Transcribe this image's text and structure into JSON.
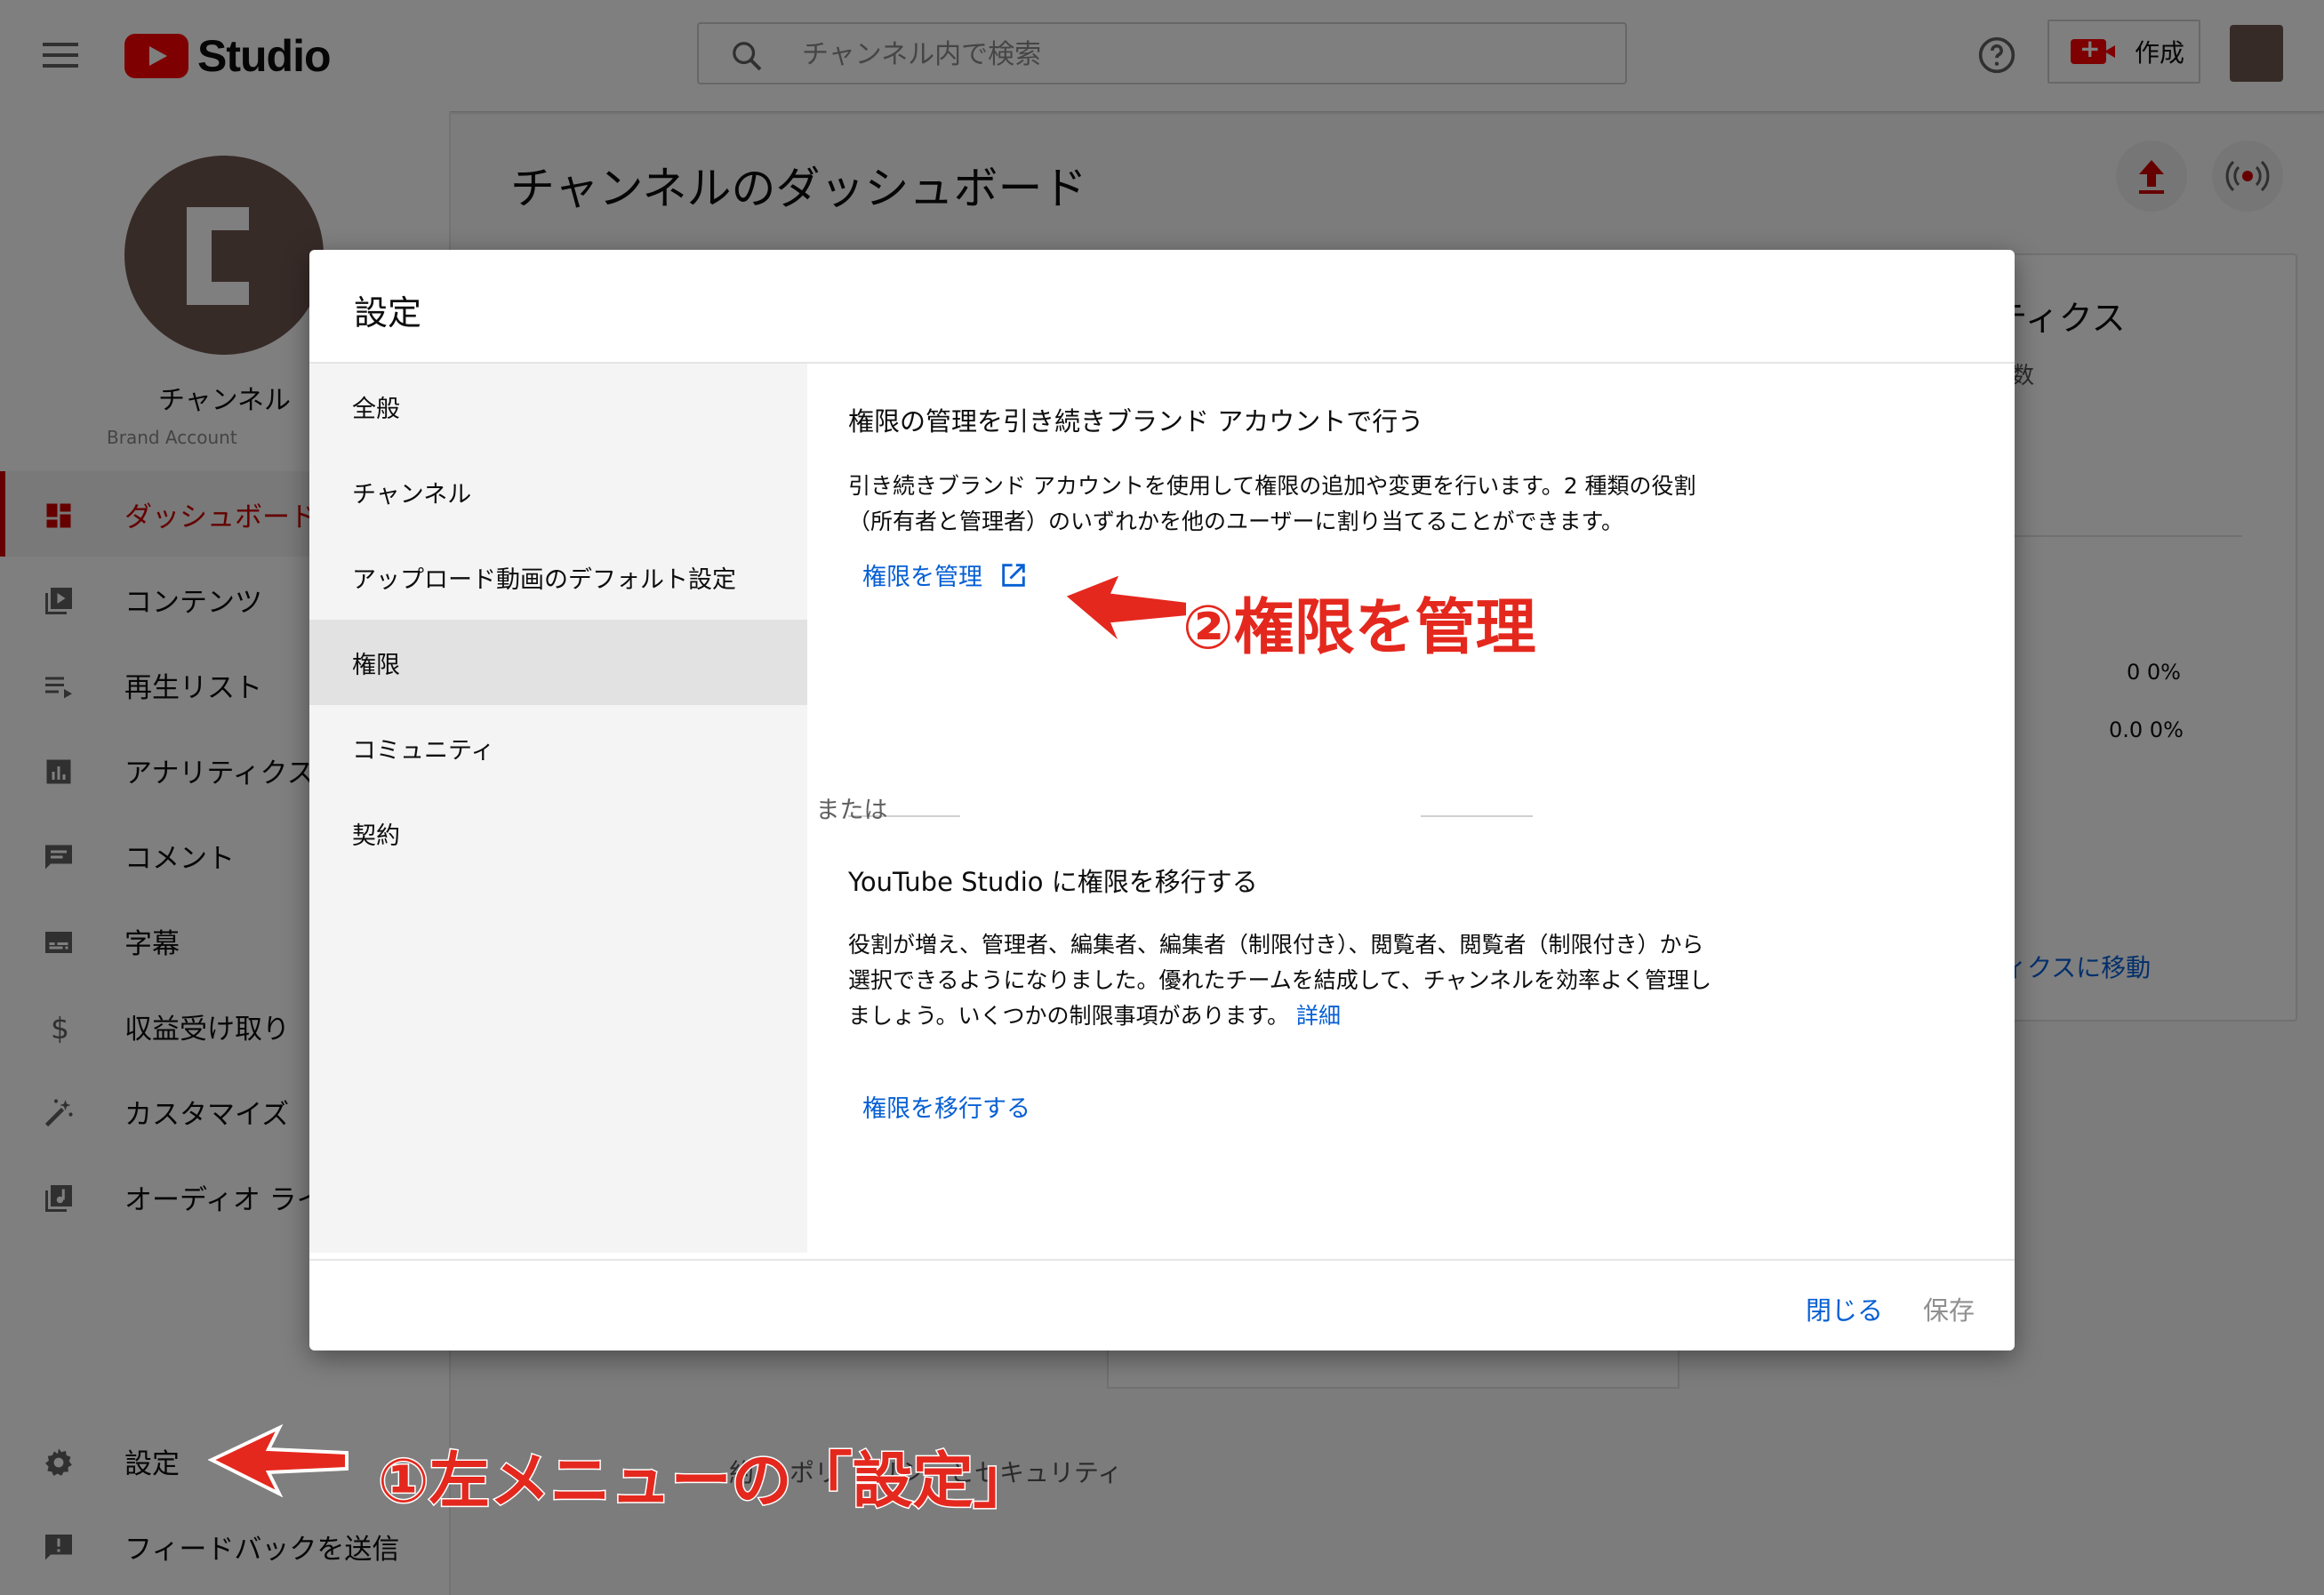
{
  "app": {
    "logo_text": "Studio",
    "search_placeholder": "チャンネル内で検索",
    "create_label": "作成"
  },
  "sidebar": {
    "channel_name": "チャンネル",
    "channel_sub": "Brand Account",
    "items": [
      {
        "label": "ダッシュボード",
        "icon": "dashboard-icon",
        "active": true
      },
      {
        "label": "コンテンツ",
        "icon": "content-icon"
      },
      {
        "label": "再生リスト",
        "icon": "playlist-icon"
      },
      {
        "label": "アナリティクス",
        "icon": "analytics-icon"
      },
      {
        "label": "コメント",
        "icon": "comment-icon"
      },
      {
        "label": "字幕",
        "icon": "subtitles-icon"
      },
      {
        "label": "収益受け取り",
        "icon": "dollar-icon"
      },
      {
        "label": "カスタマイズ",
        "icon": "magic-wand-icon"
      },
      {
        "label": "オーディオ ライ",
        "icon": "audio-library-icon"
      }
    ],
    "bottom_items": [
      {
        "label": "設定",
        "icon": "gear-icon"
      },
      {
        "label": "フィードバックを送信",
        "icon": "feedback-icon"
      }
    ]
  },
  "page": {
    "title": "チャンネルのダッシュボード",
    "analytics_card": {
      "title": "ティクス",
      "subtitle": "数",
      "value1": "0 0%",
      "value2": "0.0 0%",
      "link": "ィクスに移動"
    },
    "footer": {
      "a": "約",
      "b": "ポリ",
      "c": "リシーとセキュリティ"
    }
  },
  "dialog": {
    "title": "設定",
    "nav": [
      {
        "label": "全般"
      },
      {
        "label": "チャンネル"
      },
      {
        "label": "アップロード動画のデフォルト設定"
      },
      {
        "label": "権限",
        "active": true
      },
      {
        "label": "コミュニティ"
      },
      {
        "label": "契約"
      }
    ],
    "section1_title": "権限の管理を引き続きブランド アカウントで行う",
    "section1_text_line1": "引き続きブランド アカウントを使用して権限の追加や変更を行います。2 種類の役割",
    "section1_text_line2": "（所有者と管理者）のいずれかを他のユーザーに割り当てることができます。",
    "manage_link": "権限を管理",
    "or_text": "または",
    "section2_title": "YouTube Studio に権限を移行する",
    "section2_text_line1": "役割が増え、管理者、編集者、編集者（制限付き）、閲覧者、閲覧者（制限付き）から",
    "section2_text_line2": "選択できるようになりました。優れたチームを結成して、チャンネルを効率よく管理し",
    "section2_text_line3": "ましょう。いくつかの制限事項があります。",
    "details_link": "詳細",
    "migrate_link": "権限を移行する",
    "close_label": "閉じる",
    "save_label": "保存"
  },
  "annotations": {
    "step1": "①左メニューの「設定」",
    "step2": "②権限を管理",
    "color": "#e4281e"
  }
}
